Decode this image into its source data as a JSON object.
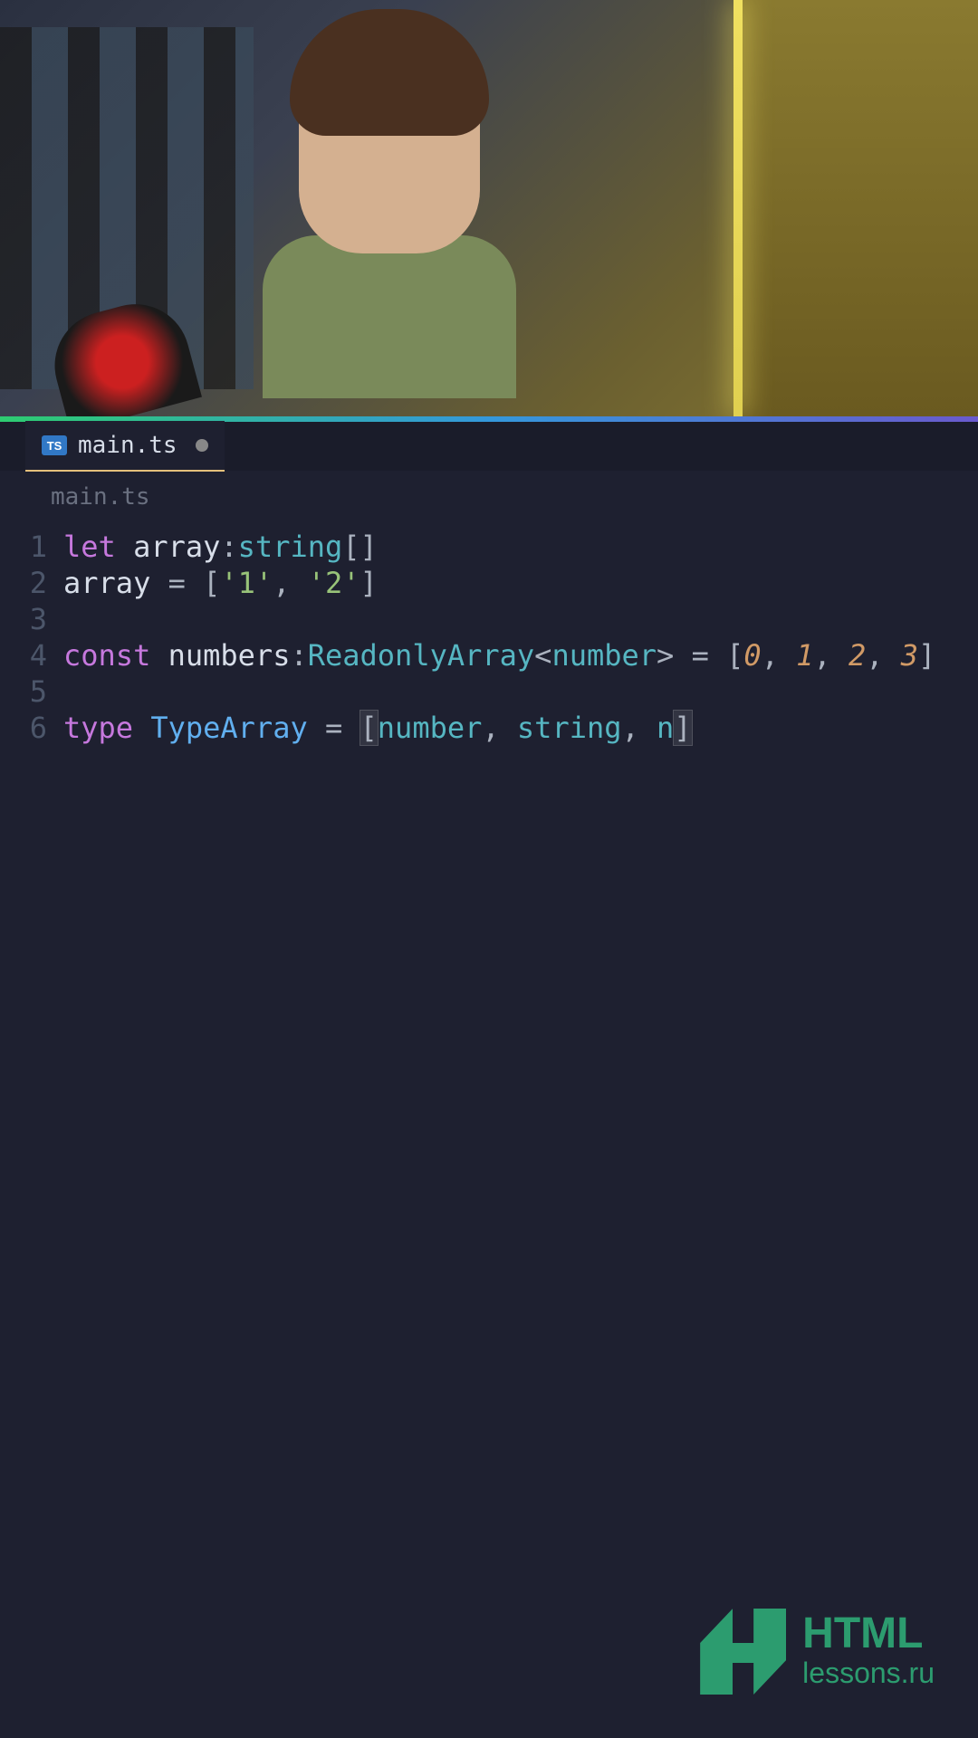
{
  "tab": {
    "badge": "TS",
    "filename": "main.ts",
    "modified": true
  },
  "breadcrumb": "main.ts",
  "code": {
    "lines": [
      {
        "num": "1",
        "tokens": [
          {
            "t": "let ",
            "cls": "kw-let"
          },
          {
            "t": "array",
            "cls": "var-name"
          },
          {
            "t": ":",
            "cls": "punct"
          },
          {
            "t": "string",
            "cls": "type-anno"
          },
          {
            "t": "[]",
            "cls": "punct"
          }
        ]
      },
      {
        "num": "2",
        "tokens": [
          {
            "t": "array ",
            "cls": "var-name"
          },
          {
            "t": "= ",
            "cls": "operator"
          },
          {
            "t": "[",
            "cls": "punct"
          },
          {
            "t": "'1'",
            "cls": "string"
          },
          {
            "t": ", ",
            "cls": "punct"
          },
          {
            "t": "'2'",
            "cls": "string"
          },
          {
            "t": "]",
            "cls": "punct"
          }
        ]
      },
      {
        "num": "3",
        "tokens": []
      },
      {
        "num": "4",
        "tokens": [
          {
            "t": "const ",
            "cls": "kw-const"
          },
          {
            "t": "numbers",
            "cls": "var-name"
          },
          {
            "t": ":",
            "cls": "punct"
          },
          {
            "t": "ReadonlyArray",
            "cls": "type-generic"
          },
          {
            "t": "<",
            "cls": "punct"
          },
          {
            "t": "number",
            "cls": "type-primitive"
          },
          {
            "t": "> ",
            "cls": "punct"
          },
          {
            "t": "= ",
            "cls": "operator"
          },
          {
            "t": "[",
            "cls": "punct"
          },
          {
            "t": "0",
            "cls": "number"
          },
          {
            "t": ", ",
            "cls": "punct"
          },
          {
            "t": "1",
            "cls": "number"
          },
          {
            "t": ", ",
            "cls": "punct"
          },
          {
            "t": "2",
            "cls": "number"
          },
          {
            "t": ", ",
            "cls": "punct"
          },
          {
            "t": "3",
            "cls": "number"
          },
          {
            "t": "]",
            "cls": "punct"
          }
        ]
      },
      {
        "num": "5",
        "tokens": []
      },
      {
        "num": "6",
        "tokens": [
          {
            "t": "type ",
            "cls": "kw-type"
          },
          {
            "t": "TypeArray",
            "cls": "type-name"
          },
          {
            "t": " = ",
            "cls": "operator"
          },
          {
            "t": "[",
            "cls": "punct bracket-hl"
          },
          {
            "t": "number",
            "cls": "type-primitive"
          },
          {
            "t": ", ",
            "cls": "punct"
          },
          {
            "t": "string",
            "cls": "type-primitive"
          },
          {
            "t": ", ",
            "cls": "punct"
          },
          {
            "t": "n",
            "cls": "type-primitive"
          },
          {
            "t": "]",
            "cls": "punct bracket-hl"
          }
        ]
      }
    ]
  },
  "logo": {
    "title": "HTML",
    "subtitle": "lessons.ru"
  }
}
